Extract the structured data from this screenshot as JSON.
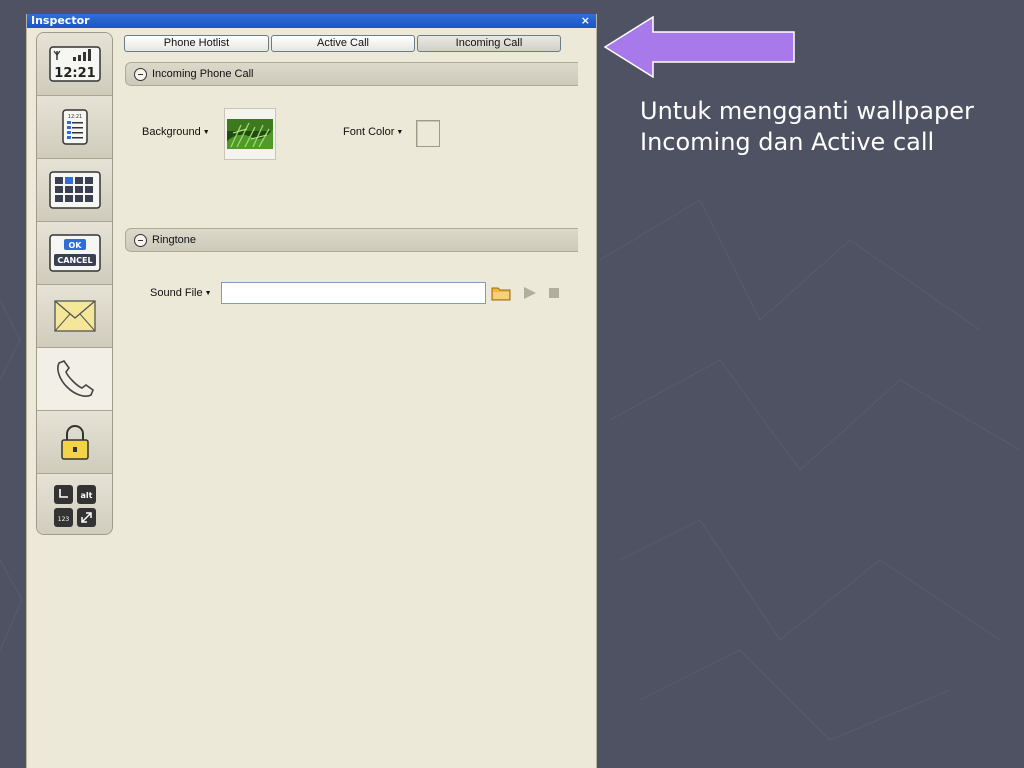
{
  "window": {
    "title": "Inspector",
    "close_glyph": "×"
  },
  "rail": {
    "items": [
      {
        "name": "status-bar",
        "icon": "phone-status-icon",
        "clock": "12:21"
      },
      {
        "name": "home-screen",
        "icon": "phone-screen-icon",
        "clock": "12:21"
      },
      {
        "name": "applications",
        "icon": "app-grid-icon"
      },
      {
        "name": "dialogs",
        "icon": "ok-cancel-icon",
        "ok": "OK",
        "cancel": "CANCEL"
      },
      {
        "name": "messages",
        "icon": "envelope-icon"
      },
      {
        "name": "phone",
        "icon": "phone-handset-icon",
        "active": true
      },
      {
        "name": "lock",
        "icon": "padlock-icon"
      },
      {
        "name": "keyboard",
        "icon": "keys-icon",
        "key_alt": "alt",
        "key_123": "123"
      }
    ]
  },
  "tabs": [
    {
      "label": "Phone Hotlist"
    },
    {
      "label": "Active Call"
    },
    {
      "label": "Incoming Call",
      "active": true
    }
  ],
  "incoming_section": {
    "title": "Incoming Phone Call",
    "background_label": "Background",
    "font_color_label": "Font Color"
  },
  "ringtone_section": {
    "title": "Ringtone",
    "sound_file_label": "Sound File",
    "sound_file_value": ""
  },
  "caption": {
    "line1": "Untuk mengganti wallpaper",
    "line2": "Incoming dan Active call"
  },
  "colors": {
    "arrow": "#a879ea",
    "titlebar": "#1c55c4",
    "panel": "#ece9d8",
    "slide_bg": "#4f5263"
  }
}
